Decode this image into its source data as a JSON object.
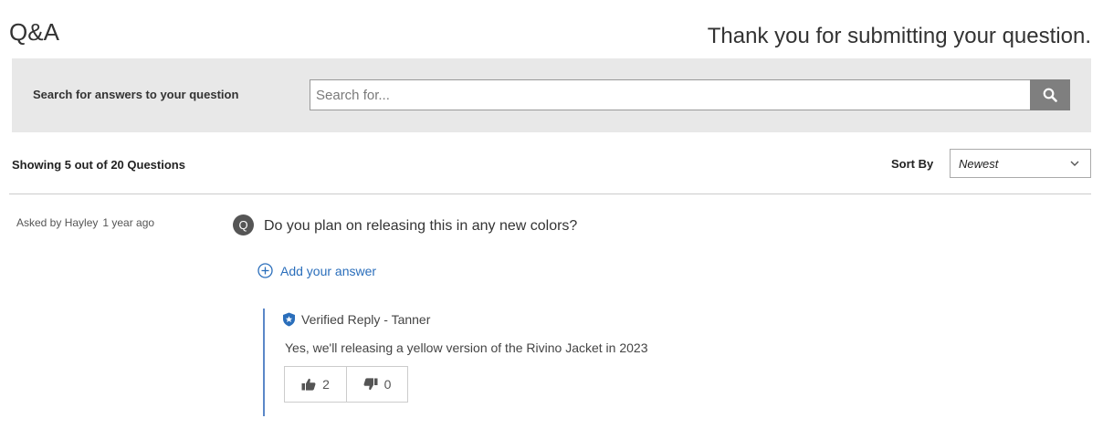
{
  "header": {
    "title": "Q&A",
    "confirmation": "Thank you for submitting your question."
  },
  "search": {
    "label": "Search for answers to your question",
    "placeholder": "Search for...",
    "button_icon": "search-icon"
  },
  "results": {
    "summary": "Showing 5 out of 20 Questions",
    "sort_label": "Sort By",
    "sort_value": "Newest"
  },
  "question": {
    "asked_by": "Asked by Hayley",
    "asked_when": "1 year ago",
    "badge": "Q",
    "text": "Do you plan on releasing this in any new colors?",
    "add_answer_label": "Add your answer"
  },
  "answer": {
    "verified_label": "Verified Reply - Tanner",
    "text": "Yes, we'll releasing a yellow version of the Rivino Jacket in 2023",
    "upvotes": "2",
    "downvotes": "0"
  },
  "colors": {
    "link": "#2a6ebb",
    "reply_border": "#5b87c8",
    "search_button": "#7f7f7f",
    "search_bar_bg": "#e8e8e8"
  }
}
